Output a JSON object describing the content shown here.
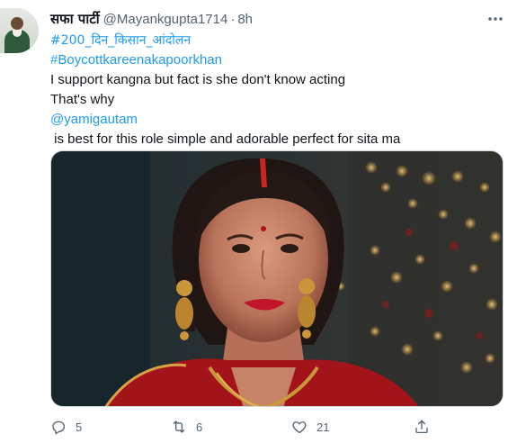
{
  "tweet": {
    "author_name": "सफा पार्टी",
    "handle": "@Mayankgupta1714",
    "separator": "·",
    "time": "8h",
    "lines": [
      {
        "text": "#200_दिन_किसान_आंदोलन",
        "link": true
      },
      {
        "text": "#Boycottkareenakapoorkhan",
        "link": true
      },
      {
        "text": "I support kangna but fact is she don't know acting",
        "link": false
      },
      {
        "text": "That's why",
        "link": false
      },
      {
        "text": "@yamigautam",
        "link": true
      },
      {
        "text": " is best for this role simple and adorable perfect for sita ma",
        "link": false
      }
    ]
  },
  "actions": {
    "reply_count": "5",
    "retweet_count": "6",
    "like_count": "21"
  },
  "icons": {
    "more": "more-icon",
    "reply": "reply-icon",
    "retweet": "retweet-icon",
    "like": "like-icon",
    "share": "share-icon"
  },
  "colors": {
    "link": "#1d9bf0",
    "secondary_text": "#536471",
    "primary_text": "#0f1419"
  }
}
